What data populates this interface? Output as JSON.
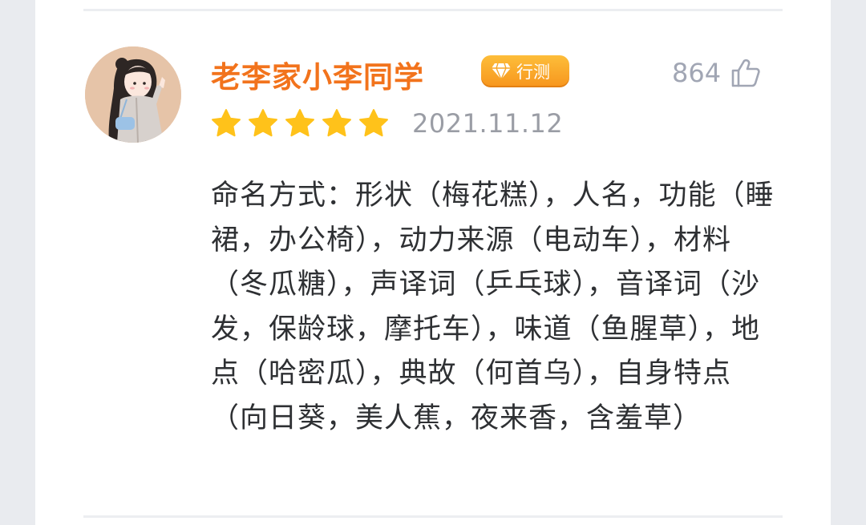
{
  "review": {
    "username": "老李家小李同学",
    "badge_label": "行测",
    "like_count": "864",
    "rating": 5,
    "rating_max": 5,
    "date": "2021.11.12",
    "content": "命名方式：形状（梅花糕），人名，功能（睡裙，办公椅），动力来源（电动车），材料（冬瓜糖），声译词（乒乓球），音译词（沙发，保龄球，摩托车），味道（鱼腥草），地点（哈密瓜），典故（何首乌），自身特点（向日葵，美人蕉，夜来香，含羞草）"
  },
  "colors": {
    "username": "#f2731c",
    "badge": "#f7951d",
    "star": "#ffc21a",
    "like_text": "#a1a6b4",
    "date_text": "#9a9da5",
    "body_text": "#2e3033"
  },
  "icons": {
    "avatar": "avatar",
    "badge": "diamond-icon",
    "like": "thumbs-up-icon",
    "rating": "star-icon"
  }
}
